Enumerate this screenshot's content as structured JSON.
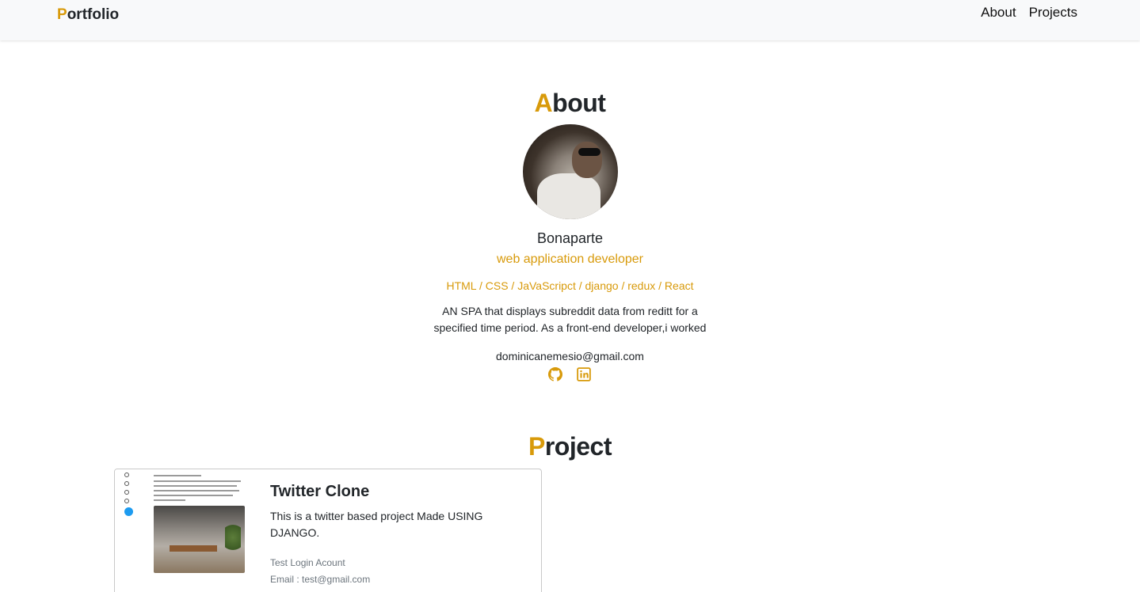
{
  "colors": {
    "accent": "#d89a0a",
    "nav_bg": "#f8f9fa",
    "text": "#212529",
    "muted": "#6c757d"
  },
  "navbar": {
    "brand_first": "P",
    "brand_rest": "ortfolio",
    "links": [
      {
        "label": "About"
      },
      {
        "label": "Projects"
      }
    ]
  },
  "about": {
    "title_first": "A",
    "title_rest": "bout",
    "name": "Bonaparte",
    "role": "web application developer",
    "skills": "HTML / CSS / JaVaScripct / django / redux / React",
    "description": "AN SPA that displays subreddit data from reditt for a specified time period. As a front-end developer,i worked",
    "email": "dominicanemesio@gmail.com",
    "socials": [
      {
        "icon": "github-icon"
      },
      {
        "icon": "linkedin-icon"
      }
    ]
  },
  "projects": {
    "title_first": "P",
    "title_rest": "roject",
    "items": [
      {
        "title": "Twitter Clone",
        "description": "This is a twitter based project Made USING DJANGO.",
        "login_label": "Test Login Acount",
        "email_line": "Email : test@gmail.com"
      }
    ]
  }
}
